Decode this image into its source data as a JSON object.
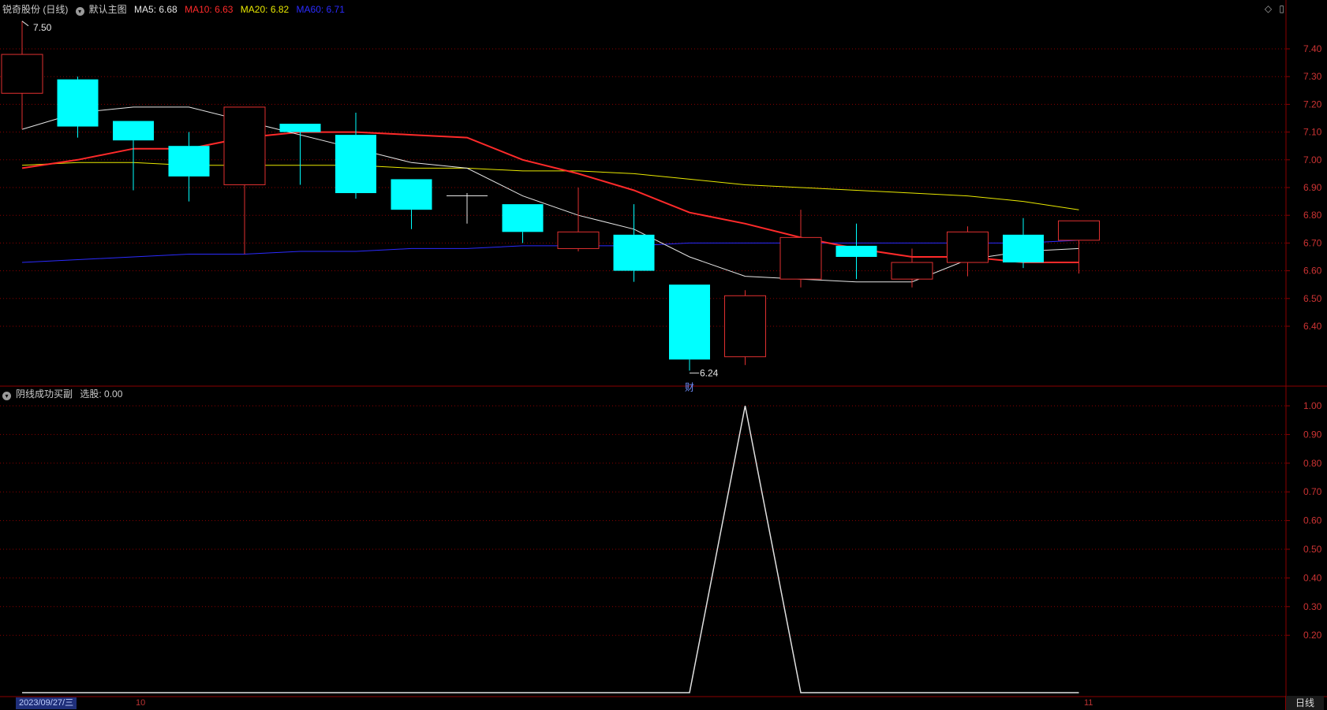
{
  "header": {
    "stock_name": "锐奇股份 (日线)",
    "main_chart_label": "默认主图",
    "indicators": [
      {
        "label": "MA5: 6.68",
        "color": "#e6e6e6"
      },
      {
        "label": "MA10: 6.63",
        "color": "#ff2a2a"
      },
      {
        "label": "MA20: 6.82",
        "color": "#e8e800"
      },
      {
        "label": "MA60: 6.71",
        "color": "#2b2bff"
      }
    ]
  },
  "sub_header": {
    "indicator_name": "阴线成功买副",
    "value_label": "选股: 0.00"
  },
  "icons": {
    "diamond": "◇",
    "panel": "▯"
  },
  "colors": {
    "up": "#e03030",
    "down": "#00ffff",
    "grid": "#8b0000",
    "axis_text": "#cc3333",
    "ma5": "#e6e6e6",
    "ma10": "#ff2a2a",
    "ma20": "#e8e800",
    "ma60": "#2b2bff",
    "signal": "#e0e0e0"
  },
  "annotations": {
    "high_label": "7.50",
    "low_label": "6.24",
    "event_marker": "财"
  },
  "x_axis": {
    "start_date": "2023/09/27/三",
    "month_labels": [
      "10",
      "11"
    ]
  },
  "period_tab": "日线",
  "chart_data": [
    {
      "type": "candlestick",
      "y_ticks": [
        7.4,
        7.3,
        7.2,
        7.1,
        7.0,
        6.9,
        6.8,
        6.7,
        6.6,
        6.5,
        6.4
      ],
      "ylim": [
        6.24,
        7.5
      ],
      "candles": [
        {
          "o": 7.24,
          "h": 7.5,
          "l": 7.11,
          "c": 7.38
        },
        {
          "o": 7.29,
          "h": 7.3,
          "l": 7.08,
          "c": 7.12
        },
        {
          "o": 7.14,
          "h": 7.14,
          "l": 6.89,
          "c": 7.07
        },
        {
          "o": 7.05,
          "h": 7.1,
          "l": 6.85,
          "c": 6.94
        },
        {
          "o": 6.91,
          "h": 7.19,
          "l": 6.66,
          "c": 7.19
        },
        {
          "o": 7.13,
          "h": 7.13,
          "l": 6.91,
          "c": 7.1
        },
        {
          "o": 7.09,
          "h": 7.17,
          "l": 6.86,
          "c": 6.88
        },
        {
          "o": 6.93,
          "h": 6.93,
          "l": 6.75,
          "c": 6.82
        },
        {
          "o": 6.87,
          "h": 6.88,
          "l": 6.77,
          "c": 6.87
        },
        {
          "o": 6.84,
          "h": 6.84,
          "l": 6.7,
          "c": 6.74
        },
        {
          "o": 6.68,
          "h": 6.9,
          "l": 6.67,
          "c": 6.74
        },
        {
          "o": 6.73,
          "h": 6.84,
          "l": 6.56,
          "c": 6.6
        },
        {
          "o": 6.55,
          "h": 6.55,
          "l": 6.24,
          "c": 6.28
        },
        {
          "o": 6.29,
          "h": 6.53,
          "l": 6.26,
          "c": 6.51
        },
        {
          "o": 6.57,
          "h": 6.82,
          "l": 6.54,
          "c": 6.72
        },
        {
          "o": 6.69,
          "h": 6.77,
          "l": 6.57,
          "c": 6.65
        },
        {
          "o": 6.57,
          "h": 6.68,
          "l": 6.54,
          "c": 6.63
        },
        {
          "o": 6.63,
          "h": 6.76,
          "l": 6.58,
          "c": 6.74
        },
        {
          "o": 6.73,
          "h": 6.79,
          "l": 6.61,
          "c": 6.63
        },
        {
          "o": 6.71,
          "h": 6.78,
          "l": 6.59,
          "c": 6.78
        }
      ],
      "ma5": [
        7.11,
        7.17,
        7.19,
        7.19,
        7.14,
        7.09,
        7.04,
        6.99,
        6.97,
        6.87,
        6.8,
        6.75,
        6.65,
        6.58,
        6.57,
        6.56,
        6.56,
        6.64,
        6.67,
        6.68
      ],
      "ma10": [
        6.97,
        7.0,
        7.04,
        7.04,
        7.08,
        7.1,
        7.1,
        7.09,
        7.08,
        7.0,
        6.95,
        6.89,
        6.81,
        6.77,
        6.72,
        6.68,
        6.65,
        6.65,
        6.63,
        6.63
      ],
      "ma20": [
        6.98,
        6.99,
        6.99,
        6.98,
        6.98,
        6.98,
        6.98,
        6.97,
        6.97,
        6.96,
        6.96,
        6.95,
        6.93,
        6.91,
        6.9,
        6.89,
        6.88,
        6.87,
        6.85,
        6.82
      ],
      "ma60": [
        6.63,
        6.64,
        6.65,
        6.66,
        6.66,
        6.67,
        6.67,
        6.68,
        6.68,
        6.69,
        6.69,
        6.69,
        6.7,
        6.7,
        6.7,
        6.7,
        6.7,
        6.7,
        6.7,
        6.71
      ]
    },
    {
      "type": "line",
      "y_ticks": [
        1.0,
        0.9,
        0.8,
        0.7,
        0.6,
        0.5,
        0.4,
        0.3,
        0.2
      ],
      "ylim": [
        0,
        1
      ],
      "values": [
        0,
        0,
        0,
        0,
        0,
        0,
        0,
        0,
        0,
        0,
        0,
        0,
        0,
        1,
        0,
        0,
        0,
        0,
        0,
        0
      ]
    }
  ]
}
